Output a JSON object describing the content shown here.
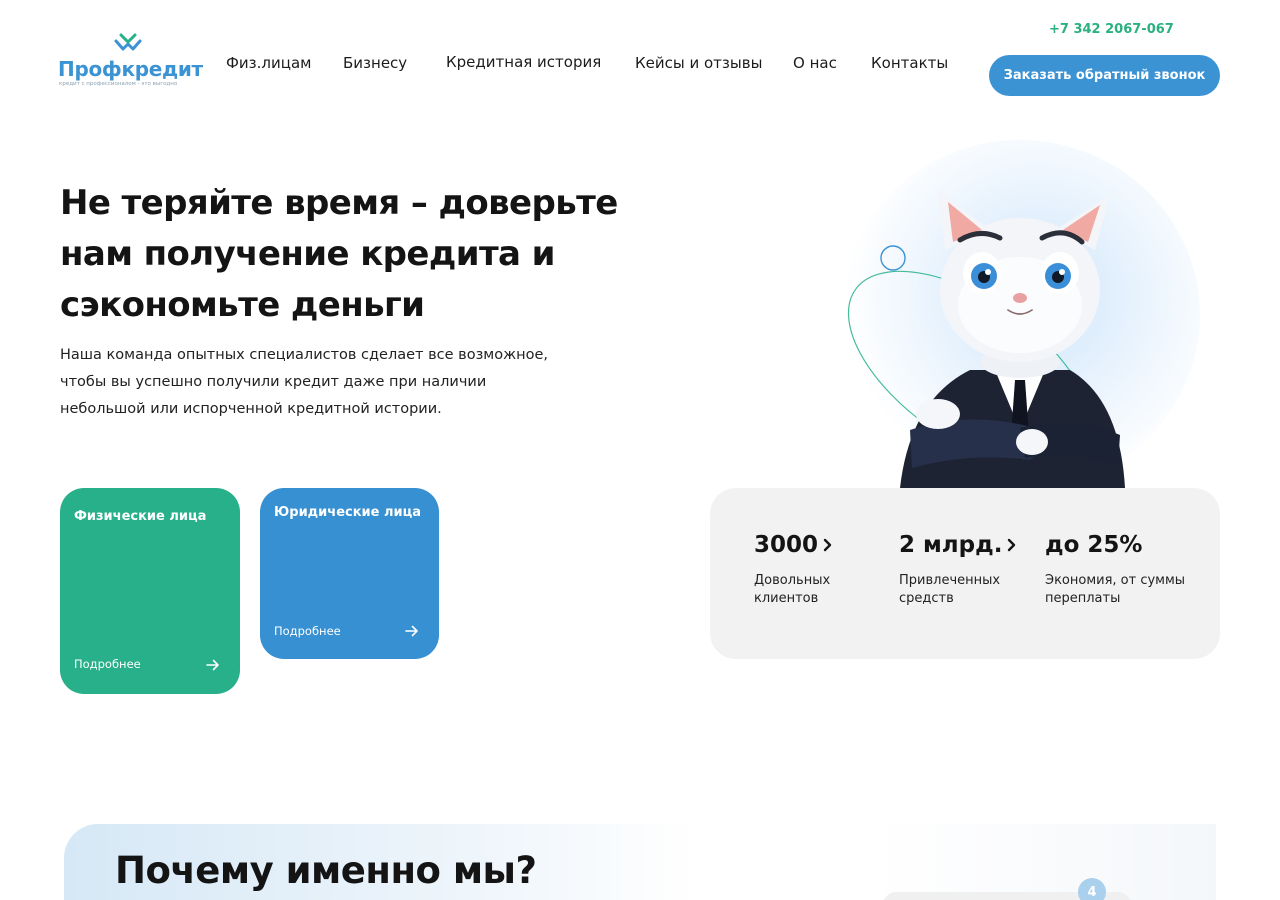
{
  "colors": {
    "brand_blue": "#3b93d4",
    "brand_green": "#27b089",
    "phone_green": "#2bb07f",
    "card_blue": "#3690d2",
    "stats_bg": "#f2f2f2"
  },
  "header": {
    "logo": {
      "name": "Профкредит",
      "tagline": "кредит с профессионалом - это выгодно",
      "icon": "logo-mark-icon"
    },
    "nav": [
      {
        "label": "Физ.лицам"
      },
      {
        "label": "Бизнесу"
      },
      {
        "label": "Кредитная история"
      },
      {
        "label": "Кейсы и отзывы"
      },
      {
        "label": "О нас"
      },
      {
        "label": "Контакты"
      }
    ],
    "phone": "+7 342 2067-067",
    "cta_label": "Заказать обратный звонок"
  },
  "hero": {
    "title": "Не теряйте время – доверьте нам получение кредита и сэкономьте деньги",
    "subtitle": "Наша команда опытных специалистов сделает все возможное, чтобы вы успешно получили кредит даже при наличии небольшой или испорченной кредитной истории."
  },
  "cards": [
    {
      "title": "Физические лица",
      "more": "Подробнее",
      "icon": "arrow-right-icon"
    },
    {
      "title": "Юридические лица",
      "more": "Подробнее",
      "icon": "arrow-right-icon"
    }
  ],
  "stats": [
    {
      "value": "3000",
      "label": "Довольных клиентов",
      "icon": "chevron-right-icon"
    },
    {
      "value": "2 млрд.",
      "label": "Привлеченных средств",
      "icon": "chevron-right-icon"
    },
    {
      "value": "до 25%",
      "label": "Экономия, от суммы переплаты"
    }
  ],
  "why": {
    "title": "Почему именно мы?",
    "badge": "4"
  }
}
